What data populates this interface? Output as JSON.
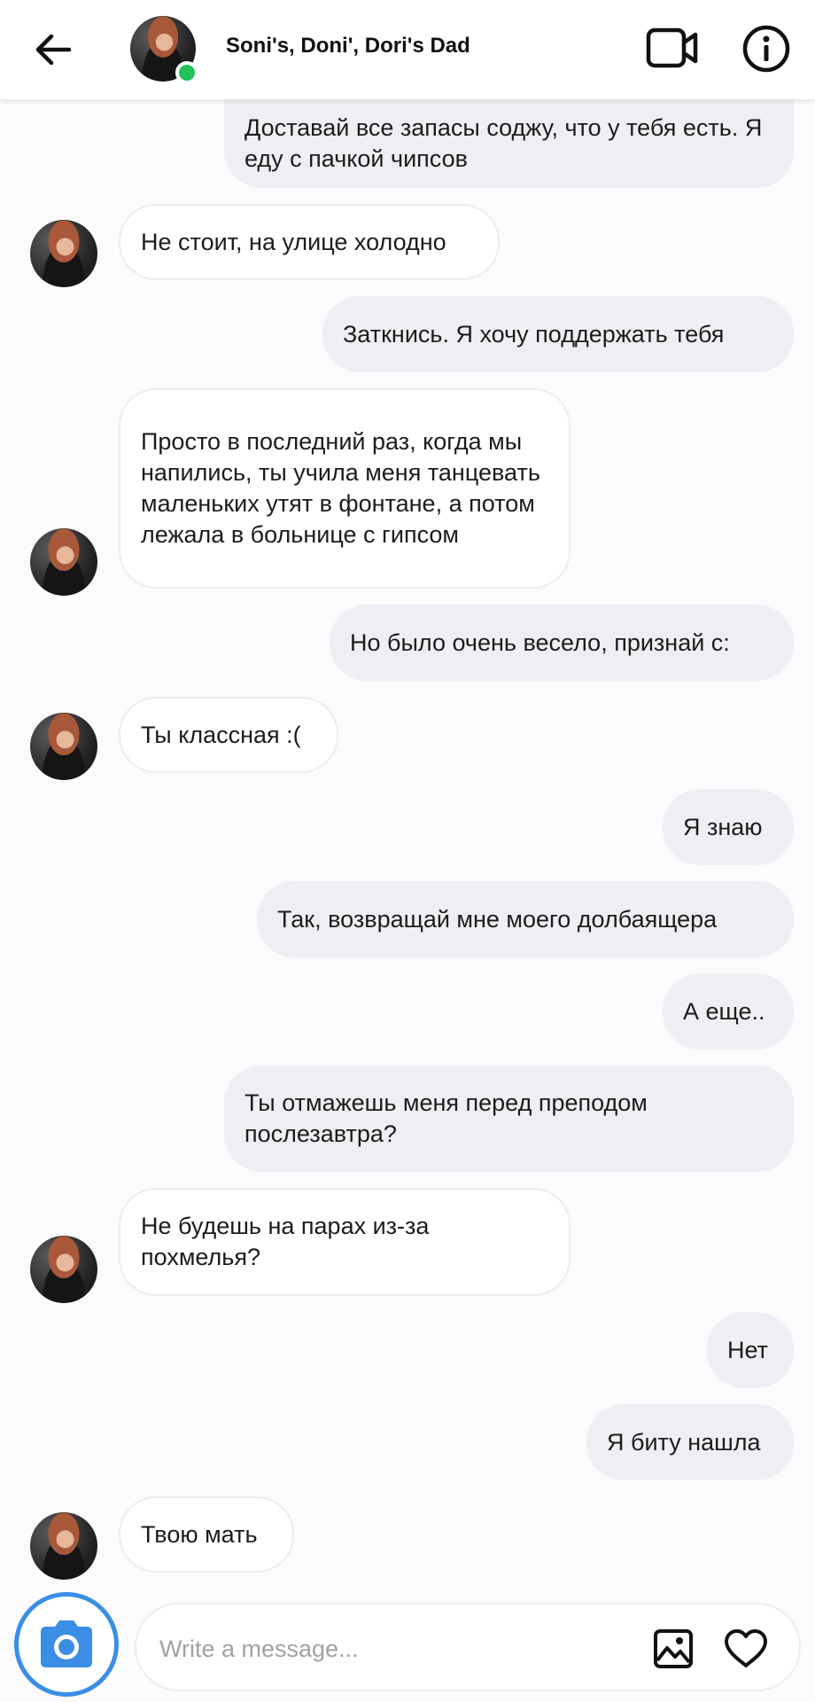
{
  "header": {
    "title": "Soni's, Doni', Dori's Dad",
    "back_icon": "arrow-left-icon",
    "video_icon": "video-camera-icon",
    "info_icon": "info-icon",
    "online_color": "#22c25a"
  },
  "messages": [
    {
      "side": "out",
      "text": "Доставай все запасы соджу, что у тебя есть. Я еду с пачкой чипсов"
    },
    {
      "side": "in",
      "text": "Не стоит, на улице холодно"
    },
    {
      "side": "out",
      "text": "Заткнись. Я хочу поддержать тебя"
    },
    {
      "side": "in",
      "text": "Просто в последний раз, когда мы напились, ты учила меня танцевать маленьких утят в фонтане, а потом лежала в больнице с гипсом"
    },
    {
      "side": "out",
      "text": "Но было очень весело, признай с:"
    },
    {
      "side": "in",
      "text": "Ты классная :("
    },
    {
      "side": "out",
      "text": "Я знаю"
    },
    {
      "side": "out",
      "text": "Так, возвращай мне моего долбаящера"
    },
    {
      "side": "out",
      "text": "А еще.."
    },
    {
      "side": "out",
      "text": "Ты отмажешь меня перед преподом послезавтра?"
    },
    {
      "side": "in",
      "text": "Не будешь на парах из-за похмелья?"
    },
    {
      "side": "out",
      "text": "Нет"
    },
    {
      "side": "out",
      "text": "Я биту нашла"
    },
    {
      "side": "in",
      "text": "Твою мать"
    }
  ],
  "composer": {
    "placeholder": "Write a message...",
    "value": "",
    "camera_icon": "camera-icon",
    "gallery_icon": "image-icon",
    "like_icon": "heart-icon",
    "accent_color": "#3b8ee6"
  }
}
